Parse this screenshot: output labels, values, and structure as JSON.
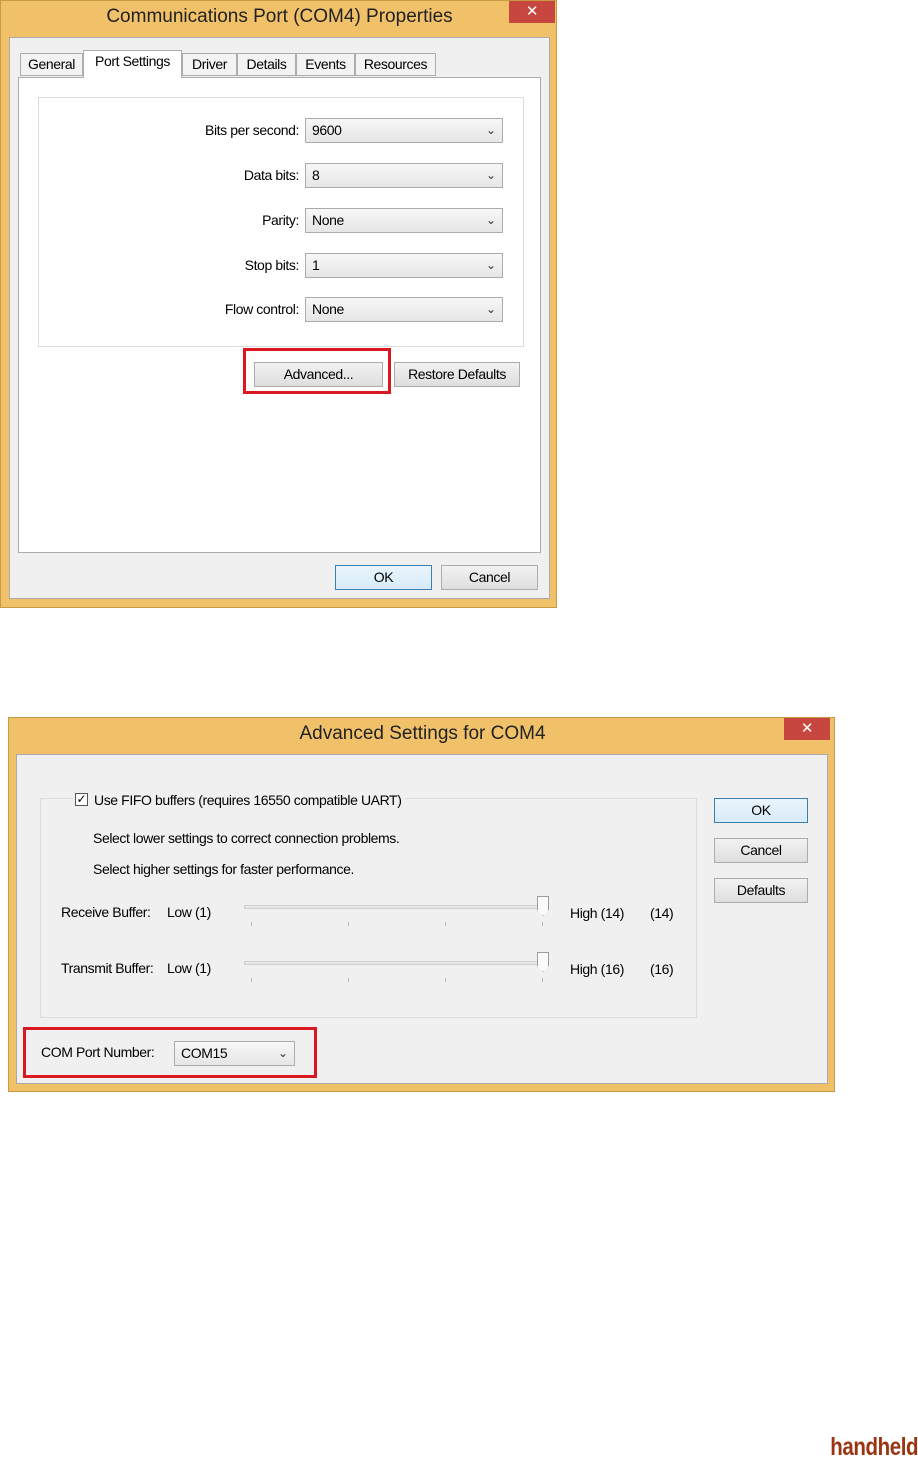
{
  "properties_dialog": {
    "title": "Communications Port (COM4) Properties",
    "close_label": "✕",
    "tabs": [
      "General",
      "Port Settings",
      "Driver",
      "Details",
      "Events",
      "Resources"
    ],
    "active_tab": "Port Settings",
    "fields": [
      {
        "label": "Bits per second:",
        "value": "9600"
      },
      {
        "label": "Data bits:",
        "value": "8"
      },
      {
        "label": "Parity:",
        "value": "None"
      },
      {
        "label": "Stop bits:",
        "value": "1"
      },
      {
        "label": "Flow control:",
        "value": "None"
      }
    ],
    "advanced_label": "Advanced...",
    "restore_label": "Restore Defaults",
    "ok_label": "OK",
    "cancel_label": "Cancel"
  },
  "advanced_dialog": {
    "title": "Advanced Settings for COM4",
    "close_label": "✕",
    "fifo_label": "Use FIFO buffers (requires 16550 compatible UART)",
    "fifo_checked": true,
    "hint_lower": "Select lower settings to correct connection problems.",
    "hint_higher": "Select higher settings for faster performance.",
    "receive": {
      "label": "Receive Buffer:",
      "low": "Low (1)",
      "high": "High (14)",
      "value": "(14)",
      "level": 1.0
    },
    "transmit": {
      "label": "Transmit Buffer:",
      "low": "Low (1)",
      "high": "High (16)",
      "value": "(16)",
      "level": 1.0
    },
    "com_port_label": "COM Port Number:",
    "com_port_value": "COM15",
    "ok_label": "OK",
    "cancel_label": "Cancel",
    "defaults_label": "Defaults"
  },
  "brand": "handheld",
  "colors": {
    "frame": "#f1c16a",
    "close": "#c7463f",
    "highlight": "#d9191f",
    "brand": "#9a3411"
  },
  "icons": {
    "close": "close-icon",
    "dropdown": "chevron-down-icon",
    "check": "checkmark-icon"
  }
}
